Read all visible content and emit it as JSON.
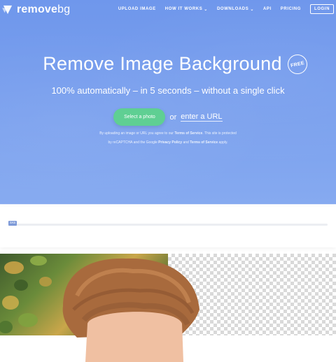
{
  "brand": {
    "name_bold": "remove",
    "name_thin": "bg",
    "logo_icon": "removebg-logo-icon"
  },
  "nav": {
    "items": [
      {
        "label": "UPLOAD IMAGE",
        "dropdown": false
      },
      {
        "label": "HOW IT WORKS",
        "dropdown": true
      },
      {
        "label": "DOWNLOADS",
        "dropdown": true
      },
      {
        "label": "API",
        "dropdown": false
      },
      {
        "label": "PRICING",
        "dropdown": false
      }
    ],
    "login_label": "LOGIN"
  },
  "hero": {
    "title": "Remove Image Background",
    "badge": "FREE",
    "subtitle": "100% automatically – in 5 seconds – without a single click",
    "select_button": "Select a photo",
    "or_text": "or",
    "url_link": "enter a URL",
    "legal_1": "By uploading an image or URL you agree to our",
    "legal_tos": "Terms of Service",
    "legal_2": ". This site is protected",
    "legal_3": "by reCAPTCHA and the Google",
    "legal_privacy": "Privacy Policy",
    "legal_and": "and",
    "legal_tos2": "Terms of Service",
    "legal_4": "apply."
  },
  "progress": {
    "label": "SAS",
    "fraction": 0.0
  },
  "colors": {
    "hero_blue": "#6f97ec",
    "cta_green": "#5fcf93",
    "progress_label_bg": "#7e9ad8",
    "hair": "#b27548",
    "skin": "#f2c3a8"
  },
  "demo": {
    "left": "original-photo",
    "right": "transparent-result"
  }
}
